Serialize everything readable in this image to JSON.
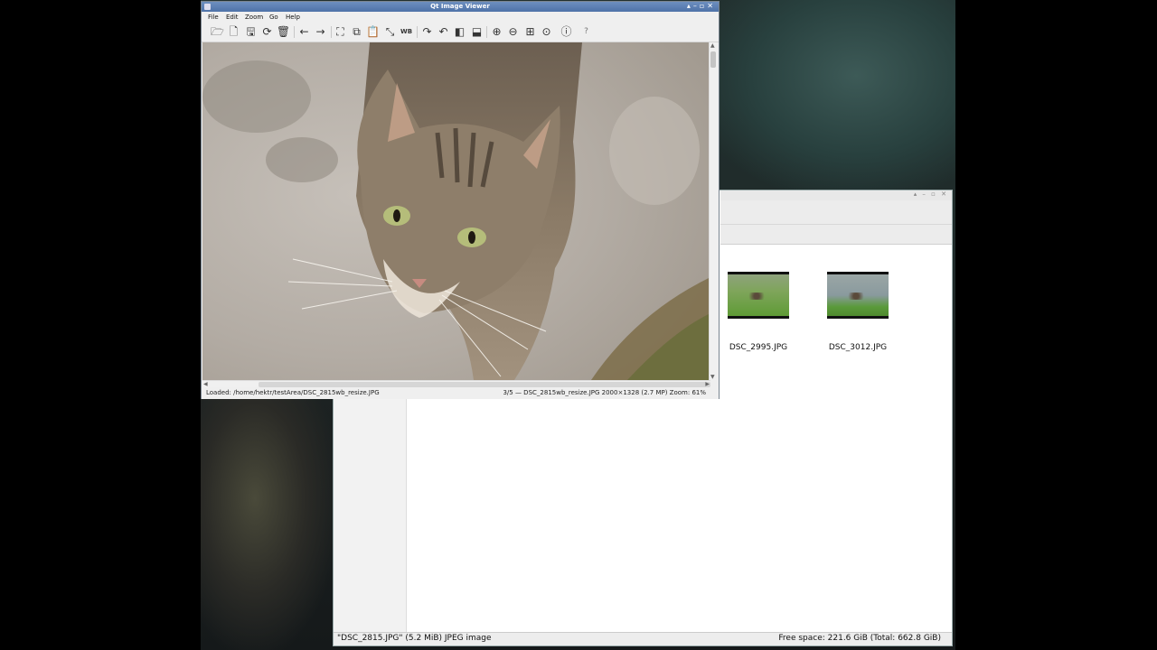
{
  "viewer": {
    "title": "Qt Image Viewer",
    "menu": [
      "File",
      "Edit",
      "Zoom",
      "Go",
      "Help"
    ],
    "toolbar": [
      {
        "icon": "open-folder-icon",
        "glyph": "🗁"
      },
      {
        "icon": "new-file-icon",
        "glyph": "🗋"
      },
      {
        "icon": "save-icon",
        "glyph": "🖫"
      },
      {
        "icon": "reload-icon",
        "glyph": "⟳"
      },
      {
        "icon": "delete-icon",
        "glyph": "🗑"
      },
      {
        "icon": "previous-arrow-icon",
        "glyph": "←"
      },
      {
        "icon": "next-arrow-icon",
        "glyph": "→"
      },
      {
        "icon": "crop-icon",
        "glyph": "⛶"
      },
      {
        "icon": "copy-icon",
        "glyph": "⧉"
      },
      {
        "icon": "paste-icon",
        "glyph": "📋"
      },
      {
        "icon": "resize-icon",
        "glyph": "⤡"
      },
      {
        "icon": "white-balance-icon",
        "glyph": "WB"
      },
      {
        "icon": "rotate-right-icon",
        "glyph": "↷"
      },
      {
        "icon": "rotate-left-icon",
        "glyph": "↶"
      },
      {
        "icon": "flip-horizontal-icon",
        "glyph": "◧"
      },
      {
        "icon": "flip-vertical-icon",
        "glyph": "⬓"
      },
      {
        "icon": "zoom-in-icon",
        "glyph": "⊕"
      },
      {
        "icon": "zoom-out-icon",
        "glyph": "⊖"
      },
      {
        "icon": "fit-to-window-icon",
        "glyph": "⊞"
      },
      {
        "icon": "original-size-icon",
        "glyph": "⊙"
      },
      {
        "icon": "info-icon",
        "glyph": "ⓘ"
      },
      {
        "icon": "help-icon",
        "glyph": "?"
      }
    ],
    "status_left": "Loaded: /home/hektr/testArea/DSC_2815wb_resize.JPG",
    "status_right": "3/5 — DSC_2815wb_resize.JPG 2000×1328 (2.7 MP)  Zoom: 61%"
  },
  "file_manager": {
    "thumbnails": [
      {
        "label": "DSC_2995.JPG"
      },
      {
        "label": "DSC_3012.JPG"
      }
    ],
    "status_left": "\"DSC_2815.JPG\" (5.2 MiB) JPEG image",
    "status_right": "Free space: 221.6 GiB (Total: 662.8 GiB)"
  }
}
